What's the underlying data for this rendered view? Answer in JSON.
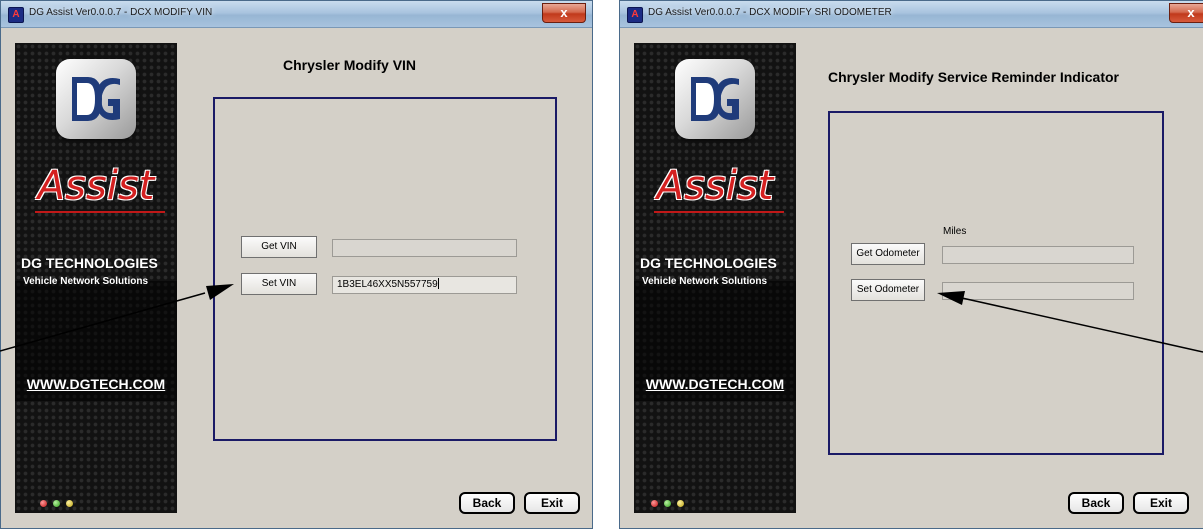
{
  "left_window": {
    "title": "DG Assist Ver0.0.0.7 - DCX MODIFY VIN",
    "close_label": "x",
    "heading": "Chrysler Modify VIN",
    "get_button": "Get VIN",
    "set_button": "Set VIN",
    "get_value": "",
    "set_value": "1B3EL46XX5N557759",
    "back_label": "Back",
    "exit_label": "Exit"
  },
  "right_window": {
    "title": "DG Assist Ver0.0.0.7 - DCX MODIFY SRI ODOMETER",
    "close_label": "x",
    "heading": "Chrysler Modify Service Reminder Indicator",
    "miles_label": "Miles",
    "get_button": "Get Odometer",
    "set_button": "Set Odometer",
    "get_value": "",
    "set_value": "",
    "back_label": "Back",
    "exit_label": "Exit"
  },
  "branding": {
    "assist_word": "Assist",
    "company": "DG TECHNOLOGIES",
    "tagline": "Vehicle Network Solutions",
    "website": "WWW.DGTECH.COM"
  },
  "status_lights": [
    "red",
    "green",
    "yellow"
  ],
  "colors": {
    "window_bg": "#d4d0c8",
    "group_border": "#1a1a66",
    "assist_red": "#d42020",
    "close_red": "#c0391c"
  }
}
